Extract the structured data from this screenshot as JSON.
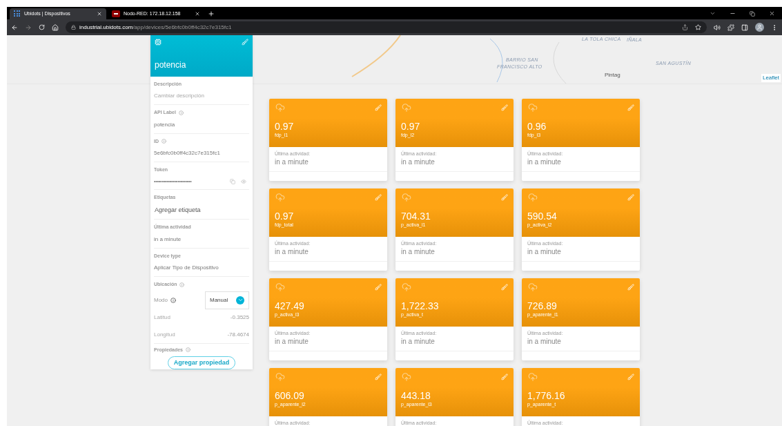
{
  "browser": {
    "tabs": [
      {
        "title": "Ubidots | Dispositivos",
        "selected": true,
        "kind": "ubidots"
      },
      {
        "title": "Nodo-RED: 172.18.12.158",
        "selected": false,
        "kind": "nodered"
      }
    ],
    "url_host": "industrial.ubidots.com",
    "url_path": "/app/devices/5e6bfc0b0ff4c32c7e315fc1"
  },
  "map": {
    "labels": [
      {
        "text": "LA TOLA CHICA",
        "kind": "area"
      },
      {
        "text": "IÑALA",
        "kind": "area"
      },
      {
        "text": "BARRIO SAN",
        "kind": "area"
      },
      {
        "text": "FRANCISCO ALTO",
        "kind": "area"
      },
      {
        "text": "SAN AGUSTÍN",
        "kind": "area"
      },
      {
        "text": "Pintag",
        "kind": "town"
      }
    ],
    "attribution": "Leaflet"
  },
  "device": {
    "name": "potencia",
    "fields": [
      {
        "label": "Descripción",
        "placeholder": "Cambiar descripción",
        "kind": "text",
        "info": false
      },
      {
        "label": "API Label",
        "value": "potencia",
        "kind": "text",
        "info": true
      },
      {
        "label": "ID",
        "value": "5e6bfc0b0ff4c32c7e315fc1",
        "kind": "text",
        "info": true
      },
      {
        "label": "Token",
        "value": "••••••••••••••••••••••••",
        "kind": "token",
        "info": false
      },
      {
        "label": "Etiquetas",
        "value": "Agregar etiqueta",
        "kind": "action",
        "info": false
      },
      {
        "label": "Última actividad",
        "value": "in a minute",
        "kind": "text",
        "info": false
      },
      {
        "label": "Device type",
        "value": "Aplicar Tipo de Dispositivo",
        "kind": "text",
        "info": false
      }
    ],
    "location": {
      "label": "Ubicación",
      "mode_label": "Modo",
      "mode": "Manual",
      "rows": [
        {
          "label": "Latitud",
          "value": "-0.3525"
        },
        {
          "label": "Longitud",
          "value": "-78.4674"
        }
      ]
    },
    "properties": {
      "label": "Propiedades",
      "button": "Agregar propiedad"
    }
  },
  "variables": [
    {
      "value": "0.97",
      "name": "fdp_l1",
      "activity_label": "Última actividad:",
      "activity": "in a minute"
    },
    {
      "value": "0.97",
      "name": "fdp_l2",
      "activity_label": "Última actividad:",
      "activity": "in a minute"
    },
    {
      "value": "0.96",
      "name": "fdp_l3",
      "activity_label": "Última actividad:",
      "activity": "in a minute"
    },
    {
      "value": "0.97",
      "name": "fdp_total",
      "activity_label": "Última actividad:",
      "activity": "in a minute"
    },
    {
      "value": "704.31",
      "name": "p_activa_l1",
      "activity_label": "Última actividad:",
      "activity": "in a minute"
    },
    {
      "value": "590.54",
      "name": "p_activa_l2",
      "activity_label": "Última actividad:",
      "activity": "in a minute"
    },
    {
      "value": "427.49",
      "name": "p_activa_l3",
      "activity_label": "Última actividad:",
      "activity": "in a minute"
    },
    {
      "value": "1,722.33",
      "name": "p_activa_t",
      "activity_label": "Última actividad:",
      "activity": "in a minute"
    },
    {
      "value": "726.89",
      "name": "p_aparente_l1",
      "activity_label": "Última actividad:",
      "activity": "in a minute"
    },
    {
      "value": "606.09",
      "name": "p_aparente_l2",
      "activity_label": "Última actividad:"
    },
    {
      "value": "443.18",
      "name": "p_aparente_l3",
      "activity_label": "Última actividad:"
    },
    {
      "value": "1,776.16",
      "name": "p_aparente_t",
      "activity_label": "Última actividad:"
    }
  ]
}
